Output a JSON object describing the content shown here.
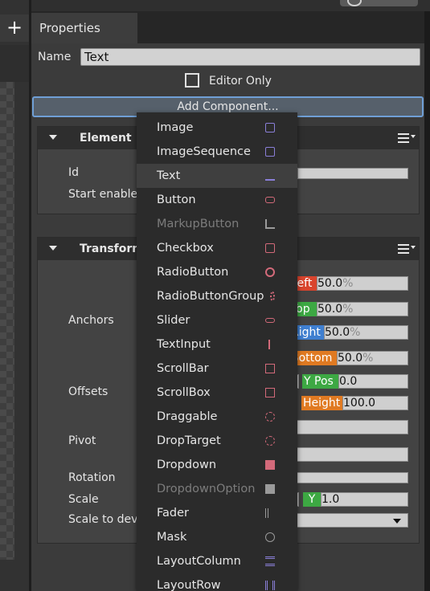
{
  "left_toolbar": {
    "add_symbol": "+"
  },
  "properties_tab": {
    "label": "Properties"
  },
  "name_row": {
    "label": "Name",
    "value": "Text"
  },
  "editor_only": {
    "label": "Editor Only",
    "checked": false
  },
  "add_component_label": "Add Component...",
  "element_component": {
    "title": "Element",
    "rows": {
      "id_label": "Id",
      "start_enabled_label": "Start enable"
    }
  },
  "transform_component": {
    "title": "Transform",
    "rows": {
      "anchors_label": "Anchors",
      "offsets_label": "Offsets",
      "pivot_label": "Pivot",
      "rotation_label": "Rotation",
      "scale_label": "Scale",
      "scale_to_device_label": "Scale to devi"
    },
    "anchors": {
      "left": {
        "tag": "Left",
        "value": "50.0",
        "unit": "%"
      },
      "top": {
        "tag": "Top",
        "value": "50.0",
        "unit": "%"
      },
      "right": {
        "tag": "Right",
        "value": "50.0",
        "unit": "%"
      },
      "bottom": {
        "tag": "Bottom",
        "value": "50.0",
        "unit": "%"
      }
    },
    "offsets": {
      "ypos": {
        "tag": "Y Pos",
        "value": "0.0"
      },
      "height": {
        "tag": "Height",
        "value": "100.0"
      }
    },
    "scale": {
      "y_tag": "Y",
      "y_value": "1.0"
    }
  },
  "component_menu": {
    "items": [
      {
        "label": "Image",
        "icon": "image-icon",
        "disabled": false
      },
      {
        "label": "ImageSequence",
        "icon": "image-sequence-icon",
        "disabled": false
      },
      {
        "label": "Text",
        "icon": "text-icon",
        "disabled": false,
        "hovered": true
      },
      {
        "label": "Button",
        "icon": "button-icon",
        "disabled": false
      },
      {
        "label": "MarkupButton",
        "icon": "markup-button-icon",
        "disabled": true
      },
      {
        "label": "Checkbox",
        "icon": "checkbox-icon",
        "disabled": false
      },
      {
        "label": "RadioButton",
        "icon": "radio-button-icon",
        "disabled": false
      },
      {
        "label": "RadioButtonGroup",
        "icon": "radio-button-group-icon",
        "disabled": false
      },
      {
        "label": "Slider",
        "icon": "slider-icon",
        "disabled": false
      },
      {
        "label": "TextInput",
        "icon": "text-input-icon",
        "disabled": false
      },
      {
        "label": "ScrollBar",
        "icon": "scrollbar-icon",
        "disabled": false
      },
      {
        "label": "ScrollBox",
        "icon": "scrollbox-icon",
        "disabled": false
      },
      {
        "label": "Draggable",
        "icon": "draggable-icon",
        "disabled": false
      },
      {
        "label": "DropTarget",
        "icon": "drop-target-icon",
        "disabled": false
      },
      {
        "label": "Dropdown",
        "icon": "dropdown-icon",
        "disabled": false
      },
      {
        "label": "DropdownOption",
        "icon": "dropdown-option-icon",
        "disabled": true
      },
      {
        "label": "Fader",
        "icon": "fader-icon",
        "disabled": false
      },
      {
        "label": "Mask",
        "icon": "mask-icon",
        "disabled": false
      },
      {
        "label": "LayoutColumn",
        "icon": "layout-column-icon",
        "disabled": false
      },
      {
        "label": "LayoutRow",
        "icon": "layout-row-icon",
        "disabled": false
      }
    ]
  },
  "colors": {
    "accent_blue": "#6f9fd6",
    "tag_left": "#d9442d",
    "tag_top": "#3da843",
    "tag_right": "#3f7fd0",
    "tag_bottom": "#e07a22",
    "icon_pink": "#d36a7a",
    "icon_purple": "#8a7fd8"
  }
}
